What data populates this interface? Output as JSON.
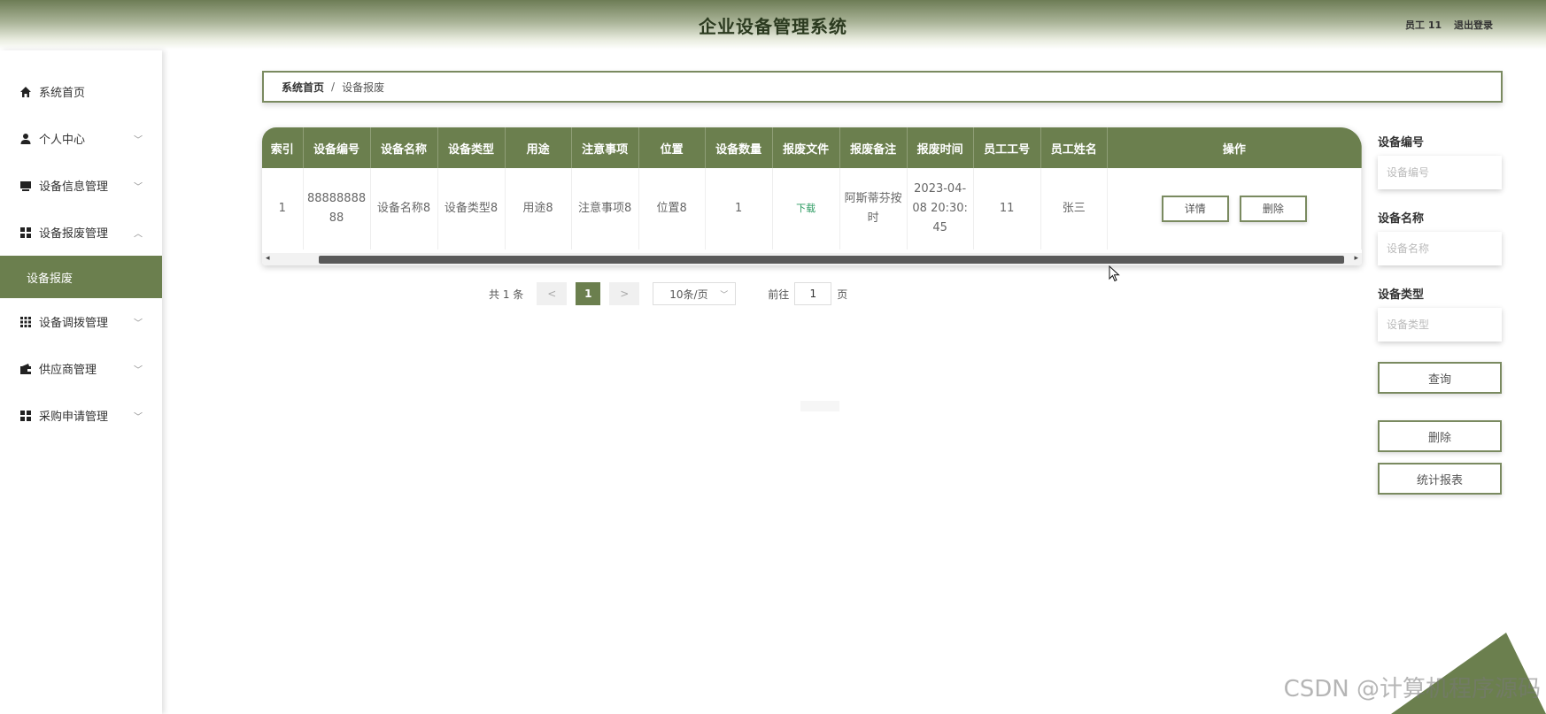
{
  "header": {
    "title": "企业设备管理系统",
    "user": "员工 11",
    "logout": "退出登录"
  },
  "sidebar": {
    "items": [
      {
        "label": "系统首页",
        "icon": "home-icon"
      },
      {
        "label": "个人中心",
        "icon": "user-icon"
      },
      {
        "label": "设备信息管理",
        "icon": "device-icon"
      },
      {
        "label": "设备报废管理",
        "icon": "grid-icon"
      },
      {
        "label": "设备调拨管理",
        "icon": "apps-icon"
      },
      {
        "label": "供应商管理",
        "icon": "wallet-icon"
      },
      {
        "label": "采购申请管理",
        "icon": "grid-icon"
      }
    ],
    "sub_active": "设备报废"
  },
  "breadcrumb": {
    "home": "系统首页",
    "separator": "/",
    "current": "设备报废"
  },
  "table": {
    "columns": [
      "索引",
      "设备编号",
      "设备名称",
      "设备类型",
      "用途",
      "注意事项",
      "位置",
      "设备数量",
      "报废文件",
      "报废备注",
      "报废时间",
      "员工工号",
      "员工姓名",
      "操作"
    ],
    "rows": [
      {
        "index": "1",
        "code": "8888888888",
        "name": "设备名称8",
        "type": "设备类型8",
        "usage": "用途8",
        "notes": "注意事项8",
        "location": "位置8",
        "quantity": "1",
        "file": "下载",
        "remark": "阿斯蒂芬按时",
        "time": "2023-04-08 20:30:45",
        "emp_no": "11",
        "emp_name": "张三",
        "detail": "详情",
        "delete": "删除"
      }
    ]
  },
  "pagination": {
    "total": "共 1 条",
    "prev": "<",
    "page": "1",
    "next": ">",
    "page_size": "10条/页",
    "goto_label": "前往",
    "goto_value": "1",
    "page_unit": "页"
  },
  "search": {
    "code_label": "设备编号",
    "code_placeholder": "设备编号",
    "name_label": "设备名称",
    "name_placeholder": "设备名称",
    "type_label": "设备类型",
    "type_placeholder": "设备类型",
    "query": "查询",
    "delete": "删除",
    "report": "统计报表"
  },
  "colors": {
    "accent": "#6b7f4e",
    "header_dark": "#6d7c55",
    "link_green": "#2a9a60"
  },
  "watermark": "CSDN @计算机程序源码"
}
